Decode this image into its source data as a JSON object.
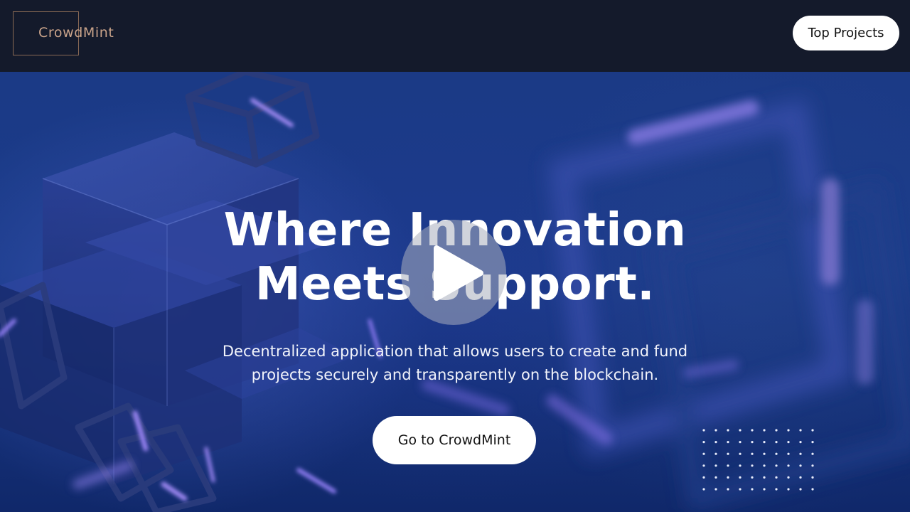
{
  "header": {
    "logo_text": "CrowdMint",
    "top_projects_label": "Top Projects"
  },
  "hero": {
    "headline_line1": "Where Innovation",
    "headline_line2": "Meets Support.",
    "subtitle": "Decentralized application that allows users to create and fund projects securely and transparently on the blockchain.",
    "cta_label": "Go to CrowdMint"
  },
  "icons": {
    "play": "play-icon"
  },
  "colors": {
    "header_bg": "#141a2b",
    "logo_accent": "#c9a38a",
    "hero_blue": "#1b3a86",
    "glow_violet": "#8a7cf0",
    "button_bg": "#ffffff"
  }
}
